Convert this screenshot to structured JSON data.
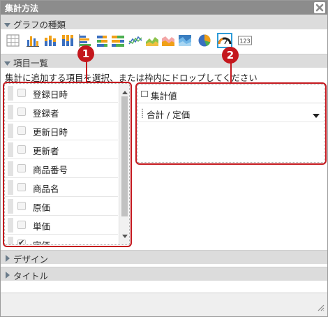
{
  "window": {
    "title": "集計方法",
    "close_icon": "close-icon"
  },
  "sections": {
    "graph_type": "グラフの種類",
    "items": "項目一覧",
    "design": "デザイン",
    "title": "タイトル"
  },
  "toolbar": {
    "buttons": [
      {
        "icon": "table-grid-icon"
      },
      {
        "icon": "bar-chart-icon"
      },
      {
        "icon": "stacked-bar-chart-icon"
      },
      {
        "icon": "stacked-100-bar-chart-icon"
      },
      {
        "icon": "horizontal-bar-chart-icon"
      },
      {
        "icon": "horizontal-stacked-bar-icon"
      },
      {
        "icon": "horizontal-100-bar-icon"
      },
      {
        "icon": "line-chart-icon"
      },
      {
        "icon": "area-chart-icon"
      },
      {
        "icon": "stacked-area-chart-icon"
      },
      {
        "icon": "area-100-chart-icon"
      },
      {
        "icon": "pie-chart-icon"
      },
      {
        "icon": "gauge-chart-icon",
        "selected": true
      },
      {
        "icon": "number-display-icon",
        "text": "123"
      }
    ]
  },
  "instruction": "集計に追加する項目を選択、または枠内にドロップしてください",
  "field_list": {
    "items": [
      {
        "label": "登録日時",
        "checked": false
      },
      {
        "label": "登録者",
        "checked": false
      },
      {
        "label": "更新日時",
        "checked": false
      },
      {
        "label": "更新者",
        "checked": false
      },
      {
        "label": "商品番号",
        "checked": false
      },
      {
        "label": "商品名",
        "checked": false
      },
      {
        "label": "原価",
        "checked": false
      },
      {
        "label": "単価",
        "checked": false
      },
      {
        "label": "定価",
        "checked": true
      }
    ]
  },
  "aggregate": {
    "header": "集計値",
    "value_label": "合計 / 定価"
  },
  "markers": {
    "one": "1",
    "two": "2"
  },
  "colors": {
    "accent_red": "#c4171d",
    "selected_blue": "#2d9bd8",
    "titlebar": "#8c8c8c"
  }
}
